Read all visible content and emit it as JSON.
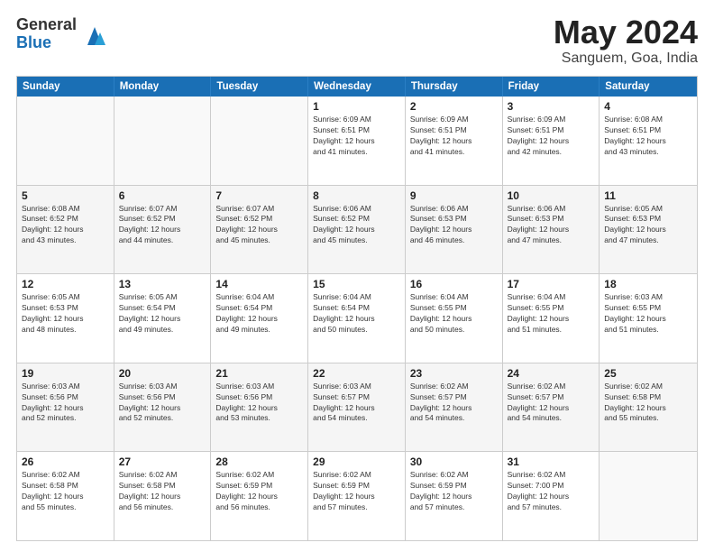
{
  "logo": {
    "general": "General",
    "blue": "Blue"
  },
  "title": "May 2024",
  "subtitle": "Sanguem, Goa, India",
  "days": [
    "Sunday",
    "Monday",
    "Tuesday",
    "Wednesday",
    "Thursday",
    "Friday",
    "Saturday"
  ],
  "rows": [
    [
      {
        "day": "",
        "empty": true
      },
      {
        "day": "",
        "empty": true
      },
      {
        "day": "",
        "empty": true
      },
      {
        "day": "1",
        "lines": [
          "Sunrise: 6:09 AM",
          "Sunset: 6:51 PM",
          "Daylight: 12 hours",
          "and 41 minutes."
        ]
      },
      {
        "day": "2",
        "lines": [
          "Sunrise: 6:09 AM",
          "Sunset: 6:51 PM",
          "Daylight: 12 hours",
          "and 41 minutes."
        ]
      },
      {
        "day": "3",
        "lines": [
          "Sunrise: 6:09 AM",
          "Sunset: 6:51 PM",
          "Daylight: 12 hours",
          "and 42 minutes."
        ]
      },
      {
        "day": "4",
        "lines": [
          "Sunrise: 6:08 AM",
          "Sunset: 6:51 PM",
          "Daylight: 12 hours",
          "and 43 minutes."
        ]
      }
    ],
    [
      {
        "day": "5",
        "lines": [
          "Sunrise: 6:08 AM",
          "Sunset: 6:52 PM",
          "Daylight: 12 hours",
          "and 43 minutes."
        ]
      },
      {
        "day": "6",
        "lines": [
          "Sunrise: 6:07 AM",
          "Sunset: 6:52 PM",
          "Daylight: 12 hours",
          "and 44 minutes."
        ]
      },
      {
        "day": "7",
        "lines": [
          "Sunrise: 6:07 AM",
          "Sunset: 6:52 PM",
          "Daylight: 12 hours",
          "and 45 minutes."
        ]
      },
      {
        "day": "8",
        "lines": [
          "Sunrise: 6:06 AM",
          "Sunset: 6:52 PM",
          "Daylight: 12 hours",
          "and 45 minutes."
        ]
      },
      {
        "day": "9",
        "lines": [
          "Sunrise: 6:06 AM",
          "Sunset: 6:53 PM",
          "Daylight: 12 hours",
          "and 46 minutes."
        ]
      },
      {
        "day": "10",
        "lines": [
          "Sunrise: 6:06 AM",
          "Sunset: 6:53 PM",
          "Daylight: 12 hours",
          "and 47 minutes."
        ]
      },
      {
        "day": "11",
        "lines": [
          "Sunrise: 6:05 AM",
          "Sunset: 6:53 PM",
          "Daylight: 12 hours",
          "and 47 minutes."
        ]
      }
    ],
    [
      {
        "day": "12",
        "lines": [
          "Sunrise: 6:05 AM",
          "Sunset: 6:53 PM",
          "Daylight: 12 hours",
          "and 48 minutes."
        ]
      },
      {
        "day": "13",
        "lines": [
          "Sunrise: 6:05 AM",
          "Sunset: 6:54 PM",
          "Daylight: 12 hours",
          "and 49 minutes."
        ]
      },
      {
        "day": "14",
        "lines": [
          "Sunrise: 6:04 AM",
          "Sunset: 6:54 PM",
          "Daylight: 12 hours",
          "and 49 minutes."
        ]
      },
      {
        "day": "15",
        "lines": [
          "Sunrise: 6:04 AM",
          "Sunset: 6:54 PM",
          "Daylight: 12 hours",
          "and 50 minutes."
        ]
      },
      {
        "day": "16",
        "lines": [
          "Sunrise: 6:04 AM",
          "Sunset: 6:55 PM",
          "Daylight: 12 hours",
          "and 50 minutes."
        ]
      },
      {
        "day": "17",
        "lines": [
          "Sunrise: 6:04 AM",
          "Sunset: 6:55 PM",
          "Daylight: 12 hours",
          "and 51 minutes."
        ]
      },
      {
        "day": "18",
        "lines": [
          "Sunrise: 6:03 AM",
          "Sunset: 6:55 PM",
          "Daylight: 12 hours",
          "and 51 minutes."
        ]
      }
    ],
    [
      {
        "day": "19",
        "lines": [
          "Sunrise: 6:03 AM",
          "Sunset: 6:56 PM",
          "Daylight: 12 hours",
          "and 52 minutes."
        ]
      },
      {
        "day": "20",
        "lines": [
          "Sunrise: 6:03 AM",
          "Sunset: 6:56 PM",
          "Daylight: 12 hours",
          "and 52 minutes."
        ]
      },
      {
        "day": "21",
        "lines": [
          "Sunrise: 6:03 AM",
          "Sunset: 6:56 PM",
          "Daylight: 12 hours",
          "and 53 minutes."
        ]
      },
      {
        "day": "22",
        "lines": [
          "Sunrise: 6:03 AM",
          "Sunset: 6:57 PM",
          "Daylight: 12 hours",
          "and 54 minutes."
        ]
      },
      {
        "day": "23",
        "lines": [
          "Sunrise: 6:02 AM",
          "Sunset: 6:57 PM",
          "Daylight: 12 hours",
          "and 54 minutes."
        ]
      },
      {
        "day": "24",
        "lines": [
          "Sunrise: 6:02 AM",
          "Sunset: 6:57 PM",
          "Daylight: 12 hours",
          "and 54 minutes."
        ]
      },
      {
        "day": "25",
        "lines": [
          "Sunrise: 6:02 AM",
          "Sunset: 6:58 PM",
          "Daylight: 12 hours",
          "and 55 minutes."
        ]
      }
    ],
    [
      {
        "day": "26",
        "lines": [
          "Sunrise: 6:02 AM",
          "Sunset: 6:58 PM",
          "Daylight: 12 hours",
          "and 55 minutes."
        ]
      },
      {
        "day": "27",
        "lines": [
          "Sunrise: 6:02 AM",
          "Sunset: 6:58 PM",
          "Daylight: 12 hours",
          "and 56 minutes."
        ]
      },
      {
        "day": "28",
        "lines": [
          "Sunrise: 6:02 AM",
          "Sunset: 6:59 PM",
          "Daylight: 12 hours",
          "and 56 minutes."
        ]
      },
      {
        "day": "29",
        "lines": [
          "Sunrise: 6:02 AM",
          "Sunset: 6:59 PM",
          "Daylight: 12 hours",
          "and 57 minutes."
        ]
      },
      {
        "day": "30",
        "lines": [
          "Sunrise: 6:02 AM",
          "Sunset: 6:59 PM",
          "Daylight: 12 hours",
          "and 57 minutes."
        ]
      },
      {
        "day": "31",
        "lines": [
          "Sunrise: 6:02 AM",
          "Sunset: 7:00 PM",
          "Daylight: 12 hours",
          "and 57 minutes."
        ]
      },
      {
        "day": "",
        "empty": true
      }
    ]
  ]
}
